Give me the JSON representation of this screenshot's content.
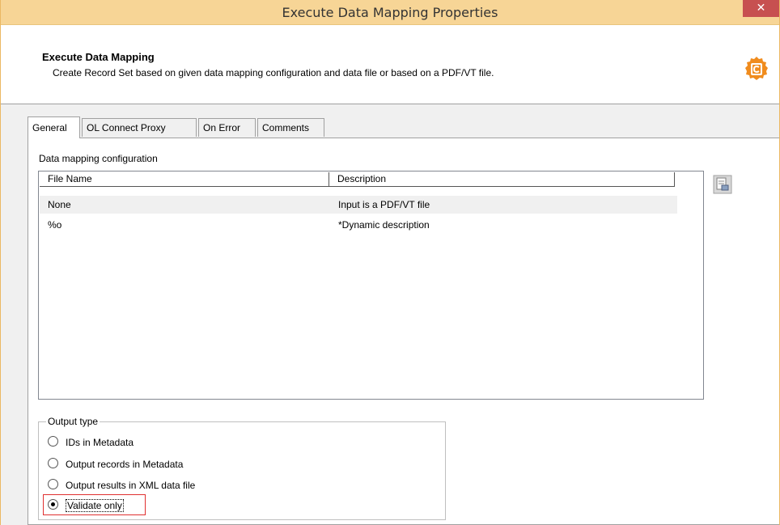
{
  "window": {
    "title": "Execute Data Mapping Properties",
    "close_label": "✕"
  },
  "header": {
    "title": "Execute Data Mapping",
    "subtitle": "Create Record Set based on given data mapping configuration and data file or based on a PDF/VT file.",
    "icon": "plugin-gear-icon"
  },
  "tabs": [
    {
      "label": "General",
      "active": true
    },
    {
      "label": "OL Connect Proxy",
      "active": false
    },
    {
      "label": "On Error",
      "active": false
    },
    {
      "label": "Comments",
      "active": false
    }
  ],
  "general": {
    "config_label": "Data mapping configuration",
    "columns": [
      "File Name",
      "Description"
    ],
    "rows": [
      {
        "file": "None",
        "description": "Input is a PDF/VT file",
        "selected": true
      },
      {
        "file": "%o",
        "description": "*Dynamic description",
        "selected": false
      }
    ],
    "browse_icon": "browse-file-icon",
    "output_type": {
      "label": "Output type",
      "options": [
        {
          "label": "IDs in Metadata",
          "checked": false
        },
        {
          "label": "Output records in Metadata",
          "checked": false
        },
        {
          "label": "Output results in XML data file",
          "checked": false
        },
        {
          "label": "Validate only",
          "checked": true
        }
      ]
    }
  },
  "colors": {
    "titlebar": "#f7d596",
    "close": "#c75050",
    "highlight": "#e03030",
    "icon_orange": "#f08c1e"
  }
}
